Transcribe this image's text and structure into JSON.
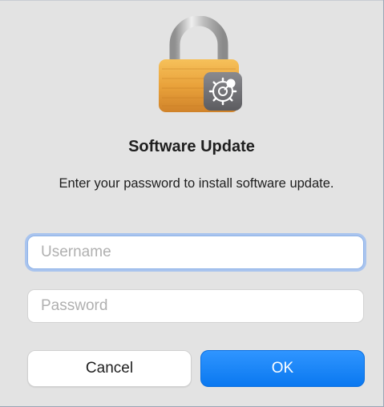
{
  "dialog": {
    "title": "Software Update",
    "message": "Enter your password to install software update.",
    "icon": "lock-with-gear-icon"
  },
  "fields": {
    "username_placeholder": "Username",
    "password_placeholder": "Password"
  },
  "buttons": {
    "cancel_label": "Cancel",
    "ok_label": "OK"
  },
  "colors": {
    "accent": "#0a84ff",
    "lock_body": "#e9a23b",
    "badge": "#6f6f73",
    "dialog_bg": "#e3e3e3"
  }
}
